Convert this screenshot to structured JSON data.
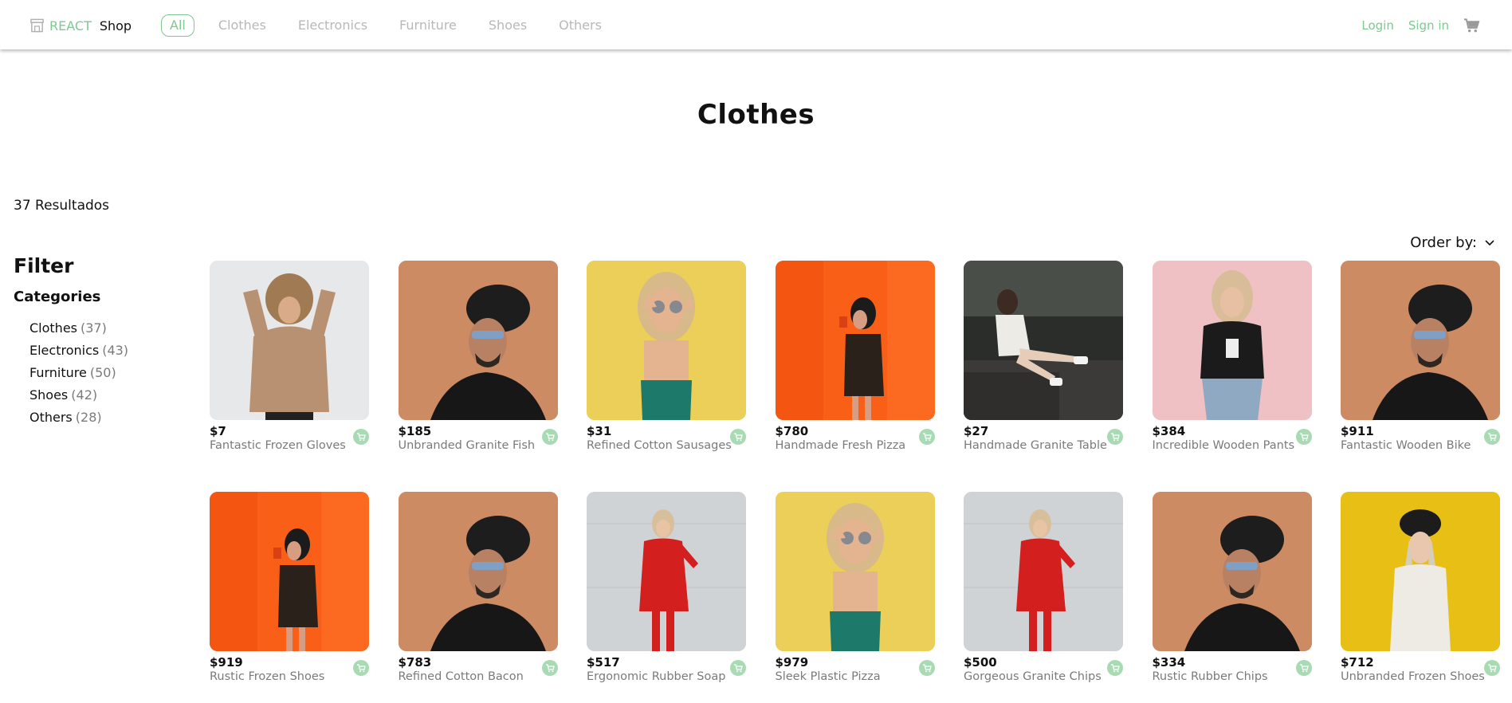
{
  "header": {
    "brand_accent": "REACT",
    "brand_main": "Shop",
    "nav": [
      "All",
      "Clothes",
      "Electronics",
      "Furniture",
      "Shoes",
      "Others"
    ],
    "active_nav": "All",
    "login": "Login",
    "signin": "Sign in"
  },
  "page": {
    "title": "Clothes",
    "results": "37 Resultados",
    "order_label": "Order by:"
  },
  "sidebar": {
    "filter_title": "Filter",
    "categories_title": "Categories",
    "categories": [
      {
        "label": "Clothes",
        "count": "(37)"
      },
      {
        "label": "Electronics",
        "count": "(43)"
      },
      {
        "label": "Furniture",
        "count": "(50)"
      },
      {
        "label": "Shoes",
        "count": "(42)"
      },
      {
        "label": "Others",
        "count": "(28)"
      }
    ]
  },
  "products": [
    {
      "price": "$7",
      "name": "Fantastic Frozen Gloves",
      "photo": "beige-sweater"
    },
    {
      "price": "$185",
      "name": "Unbranded Granite Fish",
      "photo": "hat-man-orange"
    },
    {
      "price": "$31",
      "name": "Refined Cotton Sausages",
      "photo": "yellow-woman"
    },
    {
      "price": "$780",
      "name": "Handmade Fresh Pizza",
      "photo": "orange-wall-woman"
    },
    {
      "price": "$27",
      "name": "Handmade Granite Table",
      "photo": "dark-sitting-woman"
    },
    {
      "price": "$384",
      "name": "Incredible Wooden Pants",
      "photo": "pink-wall-woman"
    },
    {
      "price": "$911",
      "name": "Fantastic Wooden Bike",
      "photo": "hat-man-orange"
    },
    {
      "price": "$919",
      "name": "Rustic Frozen Shoes",
      "photo": "orange-wall-woman"
    },
    {
      "price": "$783",
      "name": "Refined Cotton Bacon",
      "photo": "hat-man-orange"
    },
    {
      "price": "$517",
      "name": "Ergonomic Rubber Soap",
      "photo": "red-dress-woman"
    },
    {
      "price": "$979",
      "name": "Sleek Plastic Pizza",
      "photo": "yellow-woman"
    },
    {
      "price": "$500",
      "name": "Gorgeous Granite Chips",
      "photo": "red-dress-woman"
    },
    {
      "price": "$334",
      "name": "Rustic Rubber Chips",
      "photo": "hat-man-orange"
    },
    {
      "price": "$712",
      "name": "Unbranded Frozen Shoes",
      "photo": "yellow-wall-woman"
    }
  ],
  "colors": {
    "accent": "#7ec891",
    "muted": "#b8b8b8",
    "add_button": "#a8dbb4"
  },
  "icons": {
    "logo": "store-icon",
    "cart": "cart-icon",
    "order": "chevron-down-icon",
    "add": "add-to-cart-icon"
  }
}
